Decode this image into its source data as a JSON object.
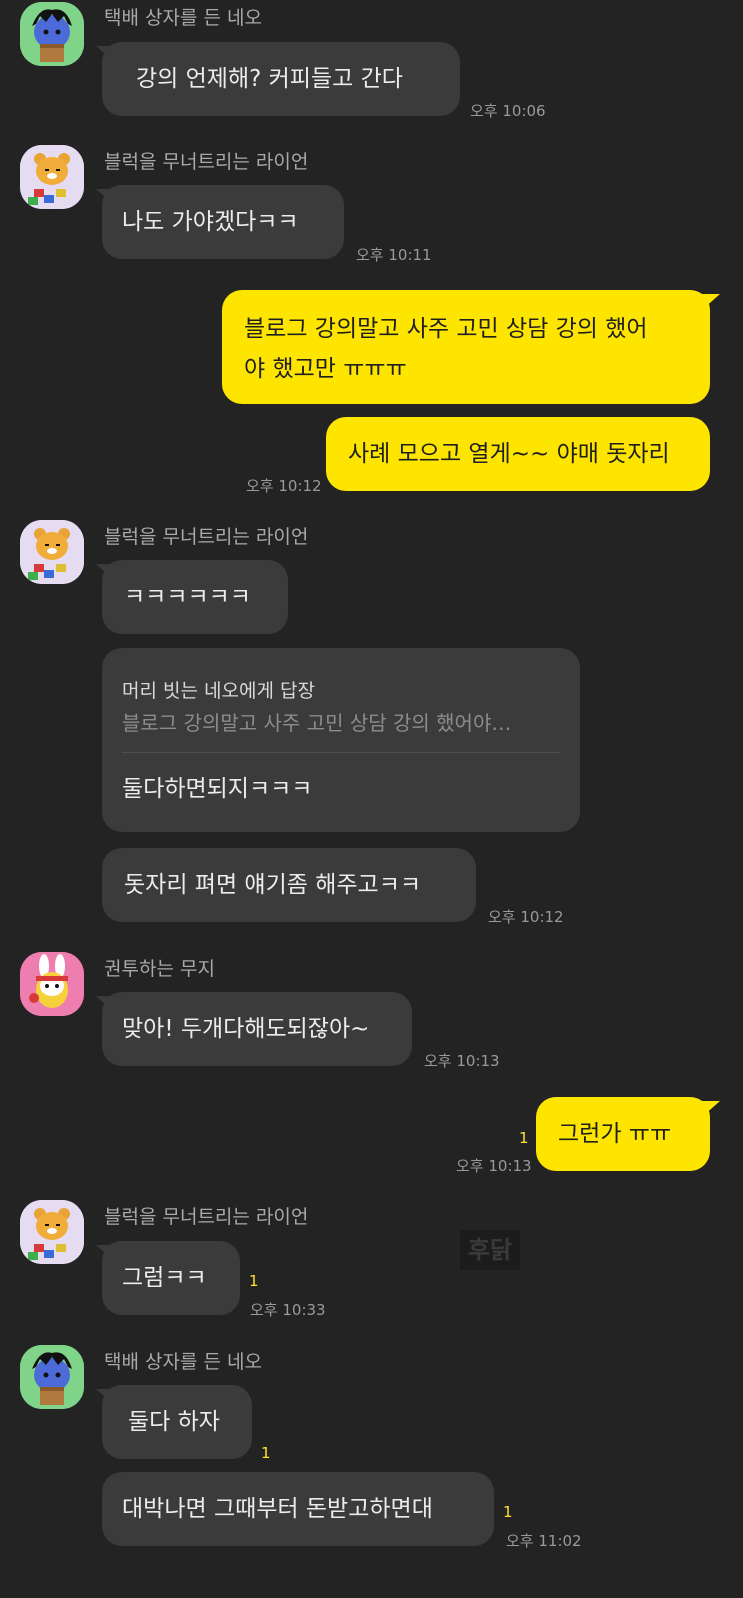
{
  "colors": {
    "background": "#232323",
    "other_bubble": "#3b3b3b",
    "my_bubble": "#fee500",
    "unread": "#ffe12e"
  },
  "messages": {
    "m1": {
      "sender": "택배 상자를 든 네오",
      "text": "강의 언제해? 커피들고 간다",
      "time": "오후 10:06"
    },
    "m2": {
      "sender": "블럭을 무너트리는 라이언",
      "text": "나도 가야겠다ㅋㅋ",
      "time": "오후 10:11"
    },
    "m3": {
      "text_line1": "블로그 강의말고 사주 고민 상담 강의 했어",
      "text_line2": "야 했고만 ㅠㅠㅠ"
    },
    "m4": {
      "text": "사례 모으고 열게~~ 야매 돗자리",
      "time": "오후 10:12"
    },
    "m5": {
      "sender": "블럭을 무너트리는 라이언",
      "text": "ㅋㅋㅋㅋㅋㅋ"
    },
    "m6": {
      "reply_to": "머리 빗는 네오에게 답장",
      "quote": "블로그 강의말고 사주 고민 상담 강의 했어야…",
      "text": "둘다하면되지ㅋㅋㅋ"
    },
    "m7": {
      "text": "돗자리 펴면 얘기좀 해주고ㅋㅋ",
      "time": "오후 10:12"
    },
    "m8": {
      "sender": "권투하는 무지",
      "text": "맞아! 두개다해도되잖아~",
      "time": "오후 10:13"
    },
    "m9": {
      "text": "그런가 ㅠㅠ",
      "time": "오후 10:13",
      "unread": "1"
    },
    "m10": {
      "sender": "블럭을 무너트리는 라이언",
      "text": "그럼ㅋㅋ",
      "time": "오후 10:33",
      "unread": "1"
    },
    "m11": {
      "sender": "택배 상자를 든 네오",
      "text": "둘다 하자",
      "unread": "1"
    },
    "m12": {
      "text": "대박나면 그때부터 돈받고하면대",
      "time": "오후 11:02",
      "unread": "1"
    }
  },
  "avatars": {
    "neo": "neo-avatar-icon",
    "ryan": "ryan-avatar-icon",
    "muzi": "muzi-avatar-icon"
  },
  "watermark": "후닭"
}
